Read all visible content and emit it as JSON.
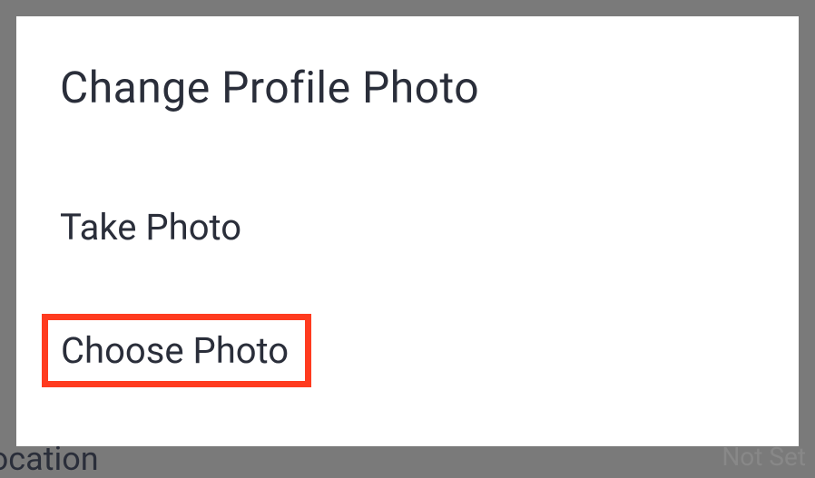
{
  "dialog": {
    "title": "Change Profile Photo",
    "options": {
      "take_photo": "Take Photo",
      "choose_photo": "Choose Photo"
    }
  },
  "background": {
    "bottom_left": "rk Location",
    "bottom_right": "Not Set"
  }
}
